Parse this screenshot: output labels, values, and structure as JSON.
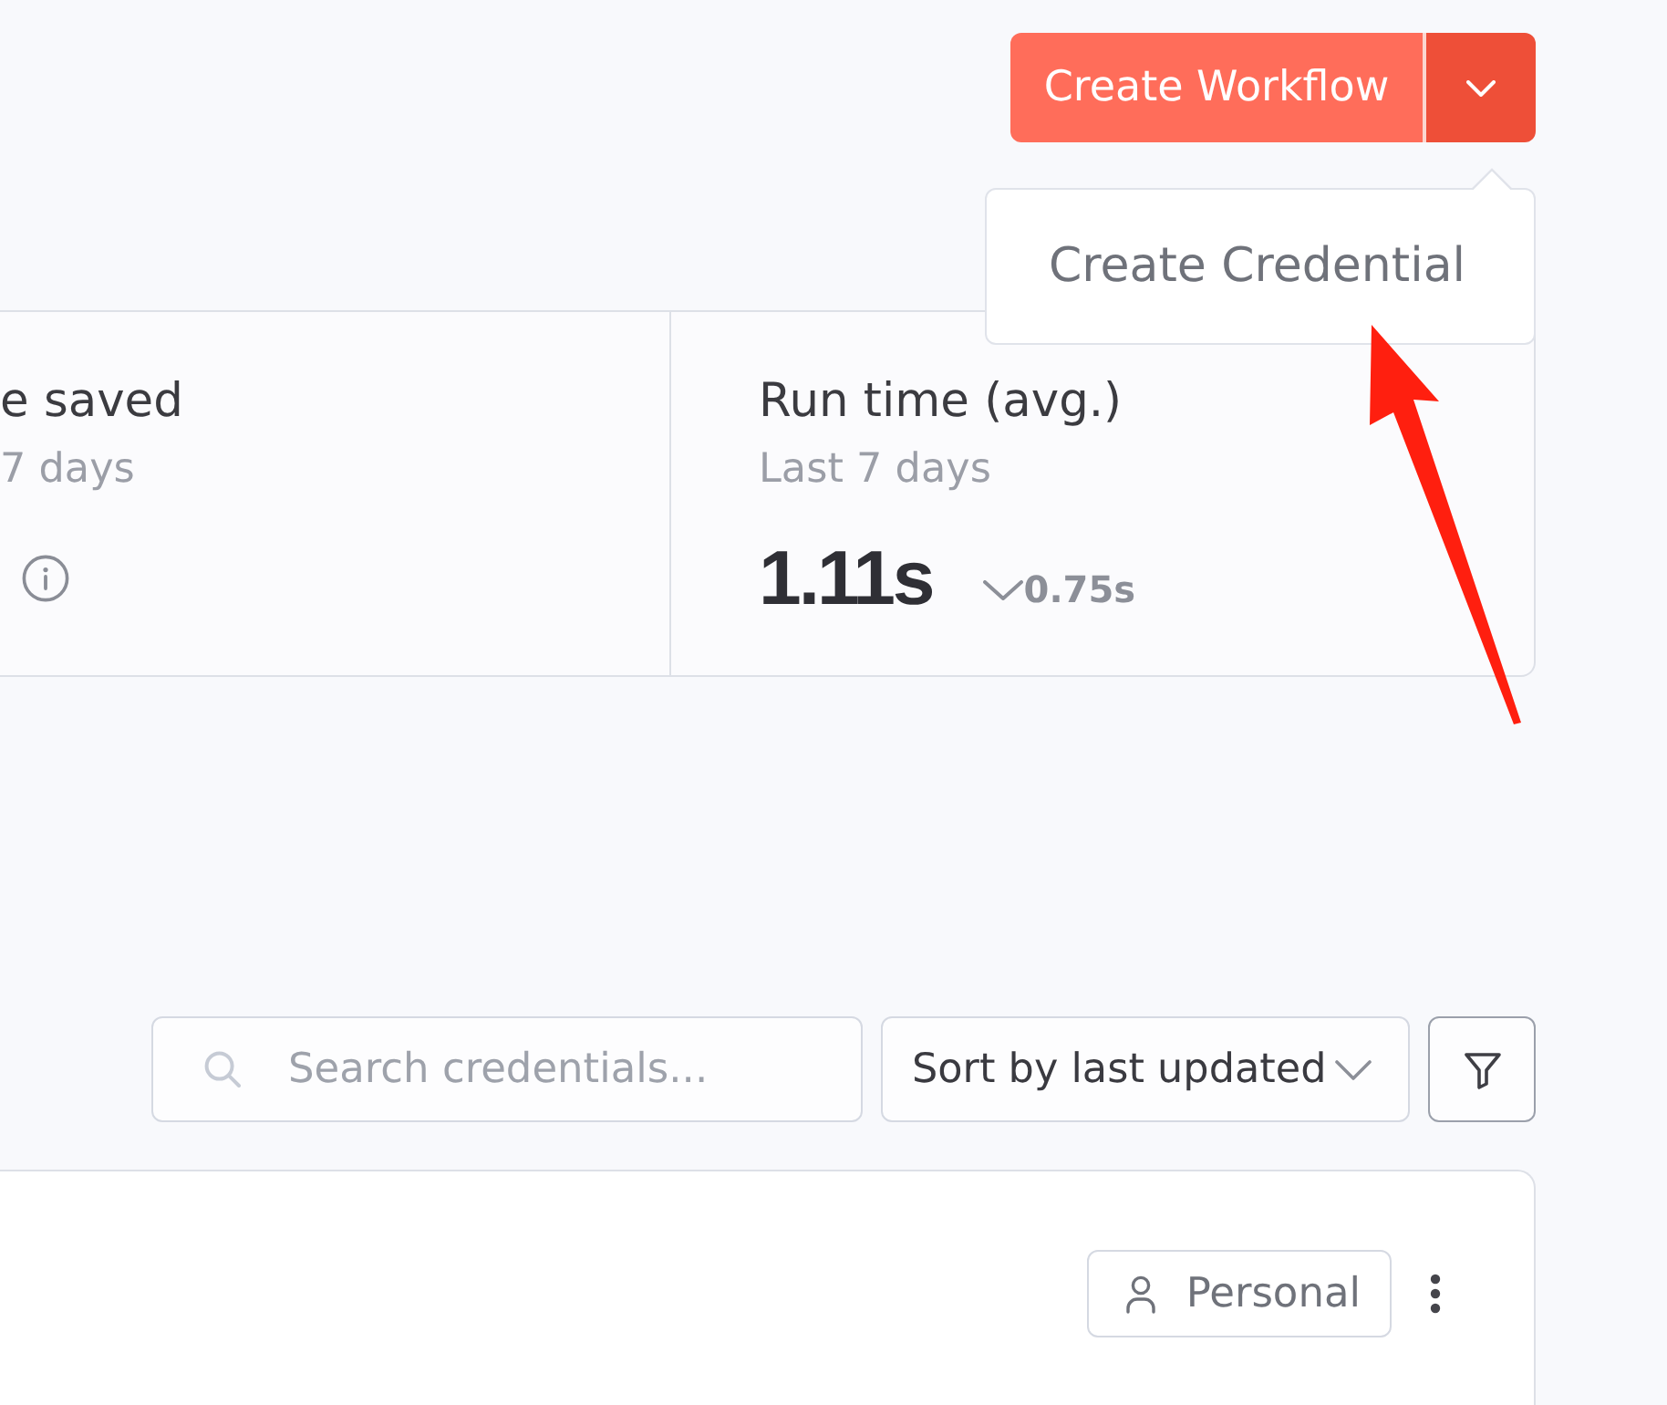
{
  "header": {
    "primary_button": {
      "label": "Create Workflow"
    },
    "dropdown": {
      "expanded": true,
      "items": [
        {
          "label": "Create Credential"
        }
      ]
    }
  },
  "stats": [
    {
      "title": "e saved",
      "subtitle": "7 days",
      "info_icon": true
    },
    {
      "title": "Run time (avg.)",
      "subtitle": "Last 7 days",
      "value": "1.11s",
      "change": {
        "decrease": true,
        "text": "0.75s"
      },
      "info_icon": false
    }
  ],
  "toolbar": {
    "search": {
      "placeholder": "Search credentials..."
    },
    "sort": {
      "value": "Sort by last updated"
    }
  },
  "credentials": [
    {
      "owner": "Personal"
    }
  ],
  "annotation": {
    "kind": "arrow"
  }
}
